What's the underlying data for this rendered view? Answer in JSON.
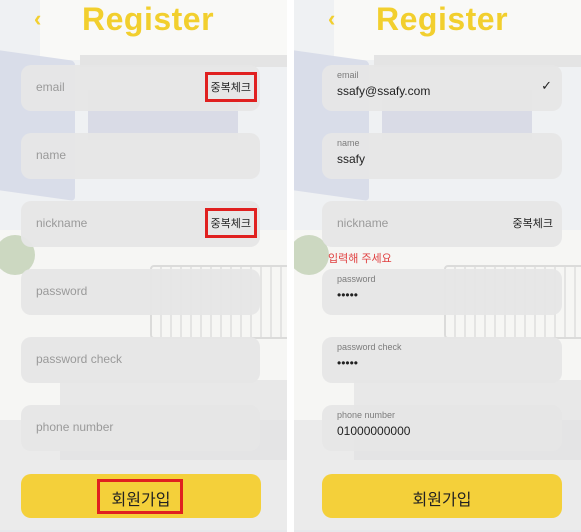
{
  "header": {
    "back_icon": "chevron-left-icon",
    "back_glyph": "‹",
    "title": "Register"
  },
  "left_form": {
    "email_placeholder": "email",
    "email_dup_label": "중복체크",
    "name_placeholder": "name",
    "nickname_placeholder": "nickname",
    "nickname_dup_label": "중복체크",
    "password_placeholder": "password",
    "password_check_placeholder": "password check",
    "phone_placeholder": "phone number",
    "submit_label": "회원가입"
  },
  "right_form": {
    "email_label": "email",
    "email_value": "ssafy@ssafy.com",
    "email_check": "✓",
    "name_label": "name",
    "name_value": "ssafy",
    "nickname_placeholder": "nickname",
    "nickname_dup_label": "중복체크",
    "nickname_error": "입력해 주세요",
    "password_label": "password",
    "password_value": "•••••",
    "password_check_label": "password check",
    "password_check_value": "•••••",
    "phone_label": "phone number",
    "phone_value": "01000000000",
    "submit_label": "회원가입"
  },
  "colors": {
    "accent": "#f4d03a",
    "highlight": "#e0201f",
    "error": "#e04040"
  }
}
